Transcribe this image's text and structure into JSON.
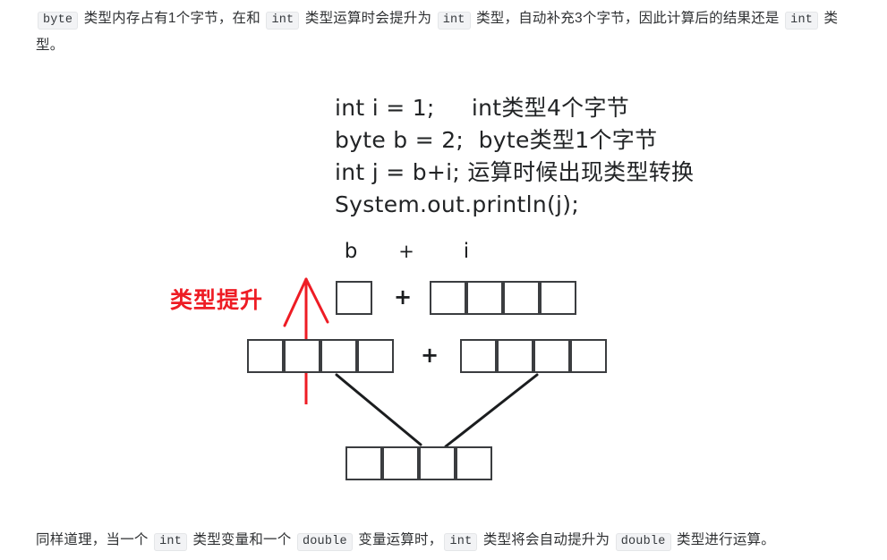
{
  "top_paragraph": {
    "segments": [
      {
        "type": "code",
        "text": "byte"
      },
      {
        "type": "text",
        "text": " 类型内存占有1个字节，在和 "
      },
      {
        "type": "code",
        "text": "int"
      },
      {
        "type": "text",
        "text": " 类型运算时会提升为 "
      },
      {
        "type": "code",
        "text": "int"
      },
      {
        "type": "text",
        "text": " 类型，自动补充3个字节，因此计算后的结果还是 "
      },
      {
        "type": "code",
        "text": "int"
      },
      {
        "type": "text",
        "text": " 类型。"
      }
    ]
  },
  "bottom_paragraph": {
    "segments": [
      {
        "type": "text",
        "text": "同样道理，当一个 "
      },
      {
        "type": "code",
        "text": "int"
      },
      {
        "type": "text",
        "text": " 类型变量和一个 "
      },
      {
        "type": "code",
        "text": "double"
      },
      {
        "type": "text",
        "text": " 变量运算时，"
      },
      {
        "type": "code",
        "text": "int"
      },
      {
        "type": "text",
        "text": " 类型将会自动提升为 "
      },
      {
        "type": "code",
        "text": "double"
      },
      {
        "type": "text",
        "text": " 类型进行运算。"
      }
    ]
  },
  "figure": {
    "code_listing": [
      "int i = 1;     int类型4个字节",
      "byte b = 2;  byte类型1个字节",
      "int j = b+i; 运算时候出现类型转换",
      "System.out.println(j);"
    ],
    "promotion_label": "类型提升",
    "promotion_label_color": "#ee1c24",
    "operand_labels": {
      "left": "b",
      "operator": "+",
      "right": "i"
    },
    "operator_row1": "+",
    "operator_row2": "+",
    "byte_boxes_count": 1,
    "int_boxes_count": 4,
    "promoted_byte_boxes_count": 4,
    "kept_int_boxes_count": 4,
    "result_boxes_count": 4
  }
}
